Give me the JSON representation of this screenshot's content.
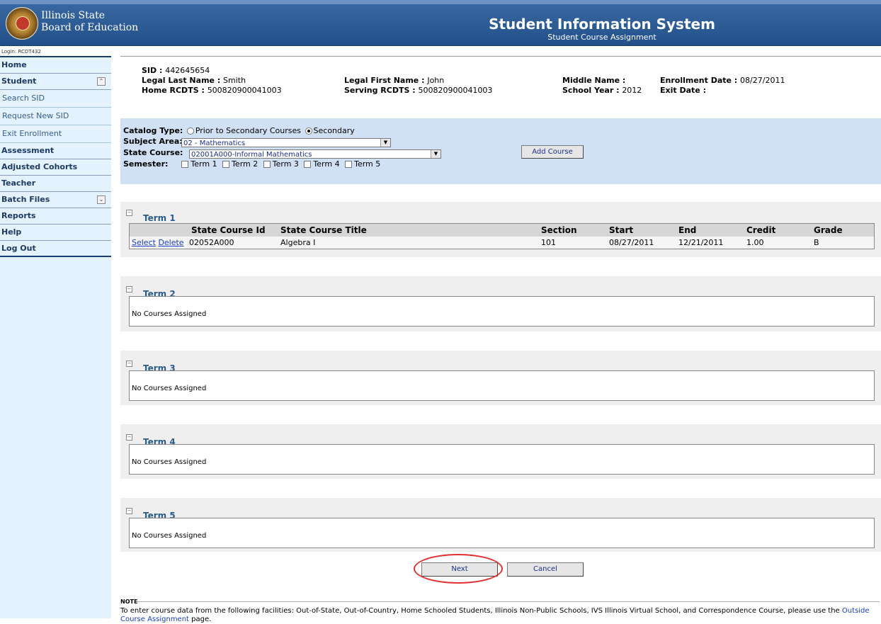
{
  "header": {
    "org_line1": "Illinois State",
    "org_line2": "Board of Education",
    "title": "Student Information System",
    "subtitle": "Student Course Assignment"
  },
  "sidebar": {
    "login": "Login: RCDT432",
    "items": [
      {
        "label": "Home",
        "type": "main"
      },
      {
        "label": "Student",
        "type": "main",
        "toggle": "collapse"
      },
      {
        "label": "Search SID",
        "type": "sub"
      },
      {
        "label": "Request New SID",
        "type": "sub"
      },
      {
        "label": "Exit Enrollment",
        "type": "sub"
      },
      {
        "label": "Assessment",
        "type": "main"
      },
      {
        "label": "Adjusted Cohorts",
        "type": "main"
      },
      {
        "label": "Teacher",
        "type": "main"
      },
      {
        "label": "Batch Files",
        "type": "main",
        "toggle": "expand"
      },
      {
        "label": "Reports",
        "type": "main"
      },
      {
        "label": "Help",
        "type": "main"
      },
      {
        "label": "Log Out",
        "type": "main"
      }
    ]
  },
  "student": {
    "sid_label": "SID : ",
    "sid": "442645654",
    "last_name_label": "Legal Last Name : ",
    "last_name": "Smith",
    "first_name_label": "Legal First Name : ",
    "first_name": "John",
    "middle_name_label": "Middle Name : ",
    "middle_name": "",
    "enroll_date_label": "Enrollment Date : ",
    "enroll_date": "08/27/2011",
    "home_rcdts_label": "Home RCDTS : ",
    "home_rcdts": "500820900041003",
    "serving_rcdts_label": "Serving RCDTS : ",
    "serving_rcdts": "500820900041003",
    "school_year_label": "School Year : ",
    "school_year": "2012",
    "exit_date_label": "Exit Date : ",
    "exit_date": ""
  },
  "filter": {
    "catalog_label": "Catalog Type:",
    "catalog_option1": "Prior to Secondary Courses",
    "catalog_option2": "Secondary",
    "catalog_selected": "Secondary",
    "subject_label": "Subject Area:",
    "subject_value": "02 - Mathematics",
    "course_label": "State Course:",
    "course_value": "02001A000-Informal Mathematics",
    "semester_label": "Semester:",
    "terms": [
      "Term 1",
      "Term 2",
      "Term 3",
      "Term 4",
      "Term 5"
    ],
    "add_course": "Add Course"
  },
  "terms": [
    {
      "title": "Term 1",
      "columns": [
        "",
        "State Course Id",
        "State Course Title",
        "Section",
        "Start",
        "End",
        "Credit",
        "Grade"
      ],
      "rows": [
        {
          "select": "Select",
          "delete": "Delete",
          "course_id": "02052A000",
          "course_title": "Algebra I",
          "section": "101",
          "start": "08/27/2011",
          "end": "12/21/2011",
          "credit": "1.00",
          "grade": "B"
        }
      ]
    },
    {
      "title": "Term 2",
      "empty": "No Courses Assigned"
    },
    {
      "title": "Term 3",
      "empty": "No Courses Assigned"
    },
    {
      "title": "Term 4",
      "empty": "No Courses Assigned"
    },
    {
      "title": "Term 5",
      "empty": "No Courses Assigned"
    }
  ],
  "actions": {
    "next": "Next",
    "cancel": "Cancel"
  },
  "note": {
    "heading": "NOTE",
    "text_before": "To enter course data from the following facilities: Out-of-State, Out-of-Country, Home Schooled Students, Illinois Non-Public Schools, IVS Illinois Virtual School, and Correspondence Course, please use the ",
    "link": "Outside Course Assignment",
    "text_after": " page."
  },
  "colors": {
    "header_bg": "#2b5a8f",
    "sidebar_bg": "#e3f2fc",
    "filter_bg": "#d1e1f5",
    "highlight": "#e03030"
  }
}
